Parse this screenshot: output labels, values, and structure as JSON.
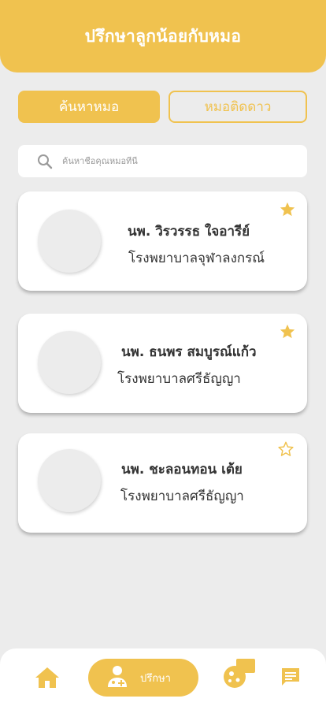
{
  "header": {
    "title": "ปรึกษาลูกน้อยกับหมอ"
  },
  "tabs": {
    "search_label": "ค้นหาหมอ",
    "favorite_label": "หมอติดดาว"
  },
  "search": {
    "placeholder": "ค้นหาชื่อคุณหมอที่นี่"
  },
  "doctors": [
    {
      "name": "นพ. วิรวรรธ ใจอารีย์",
      "hospital": "โรงพยาบาลจุฬาลงกรณ์",
      "starred": true
    },
    {
      "name": "นพ. ธนพร สมบูรณ์แก้ว",
      "hospital": "โรงพยาบาลศรีธัญญา",
      "starred": true
    },
    {
      "name": "นพ. ชะลอนทอน เต้ย",
      "hospital": "โรงพยาบาลศรีธัญญา",
      "starred": false
    }
  ],
  "bottom_nav": {
    "consult_label": "ปรึกษา"
  },
  "colors": {
    "accent": "#f0c24f",
    "background": "#ececec",
    "card": "#ffffff"
  },
  "icons": [
    "search-icon",
    "star-filled-icon",
    "star-outline-icon",
    "home-icon",
    "doctor-icon",
    "virus-icon",
    "chat-icon"
  ]
}
